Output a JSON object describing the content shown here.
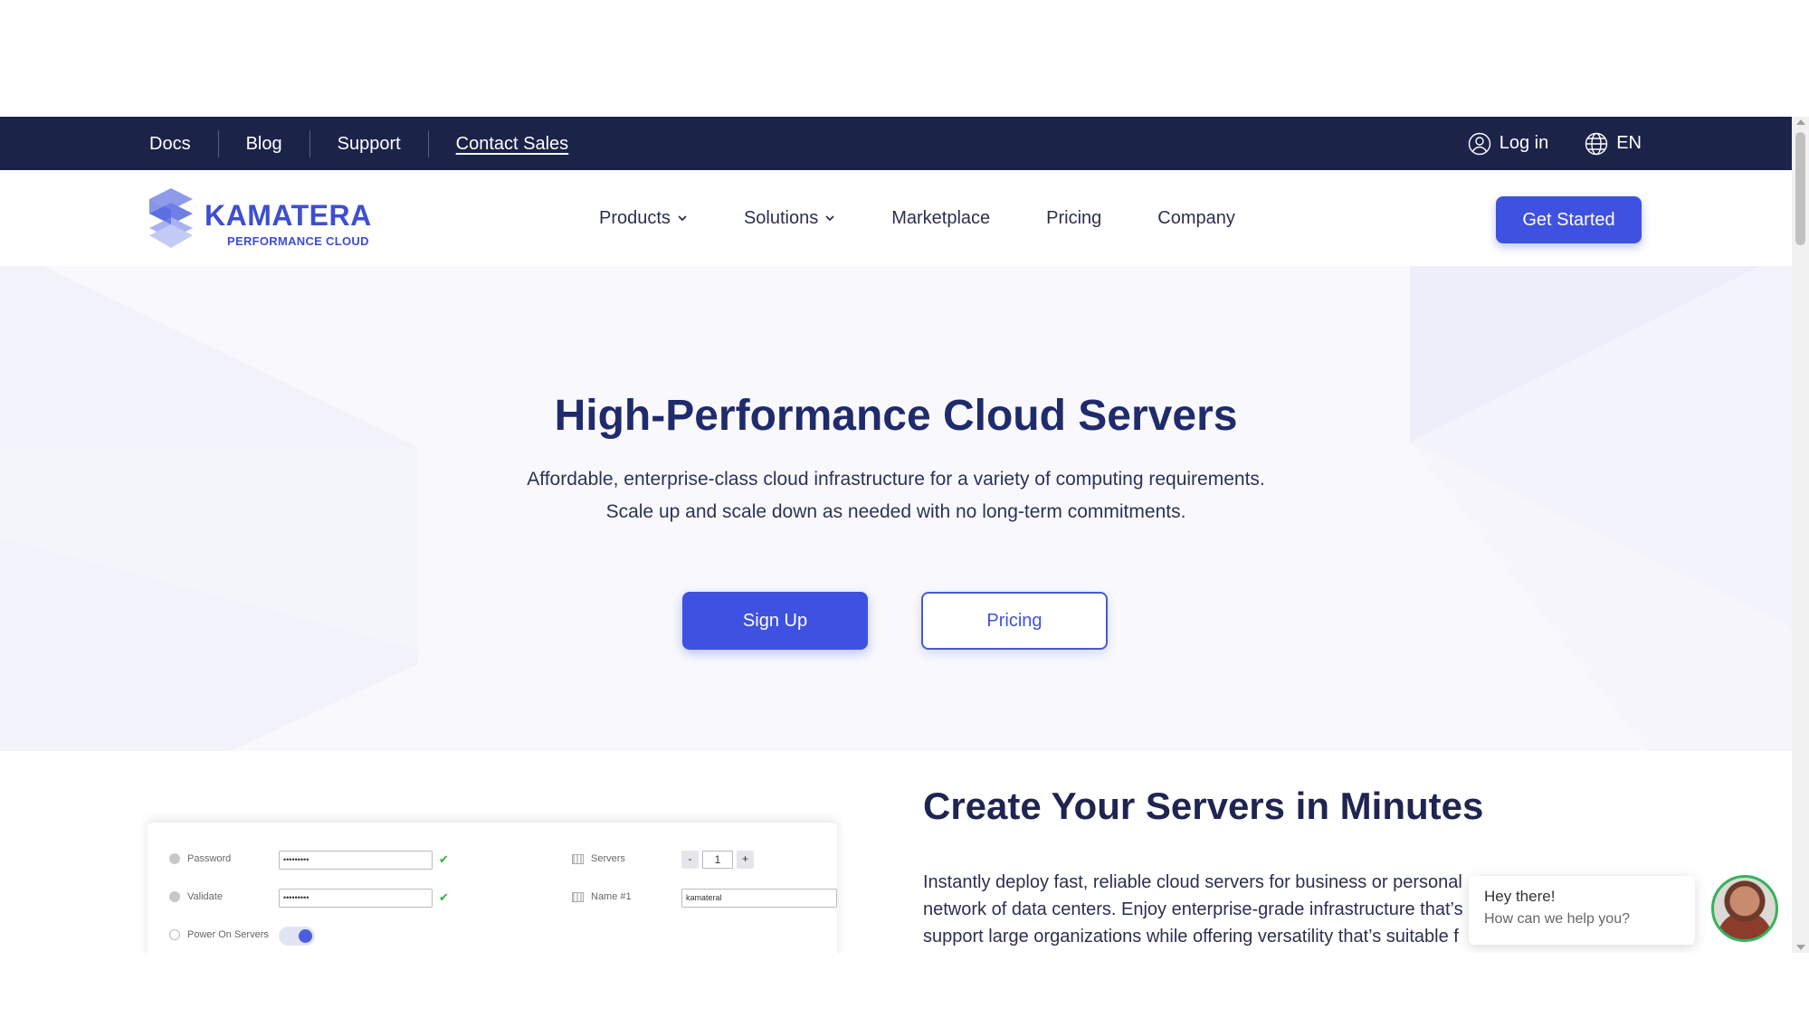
{
  "topbar": {
    "links": [
      "Docs",
      "Blog",
      "Support",
      "Contact Sales"
    ],
    "login_label": "Log in",
    "language": "EN"
  },
  "logo": {
    "name": "KAMATERA",
    "tagline": "PERFORMANCE CLOUD"
  },
  "nav": {
    "items": [
      "Products",
      "Solutions",
      "Marketplace",
      "Pricing",
      "Company"
    ],
    "cta": "Get Started"
  },
  "hero": {
    "title": "High-Performance Cloud Servers",
    "subtitle_line1": "Affordable, enterprise-class cloud infrastructure for a variety of computing requirements.",
    "subtitle_line2": "Scale up and scale down as needed with no long-term commitments.",
    "primary_button": "Sign Up",
    "secondary_button": "Pricing"
  },
  "section": {
    "title": "Create Your Servers in Minutes",
    "body": "Instantly deploy fast, reliable cloud servers for business or personal network of data centers. Enjoy enterprise-grade infrastructure that’s support large organizations while offering versatility that’s suitable f"
  },
  "mockup": {
    "password_label": "Password",
    "password_value": "•••••••••",
    "validate_label": "Validate",
    "validate_value": "•••••••••",
    "power_label": "Power On Servers",
    "servers_label": "Servers",
    "servers_value": "1",
    "name_label": "Name #1",
    "name_value": "kamateral",
    "minus": "-",
    "plus": "+"
  },
  "chat": {
    "greeting": "Hey there!",
    "prompt": "How can we help you?"
  },
  "colors": {
    "navy": "#1b2349",
    "accent": "#3f51e0",
    "heading": "#1f2b6b"
  }
}
